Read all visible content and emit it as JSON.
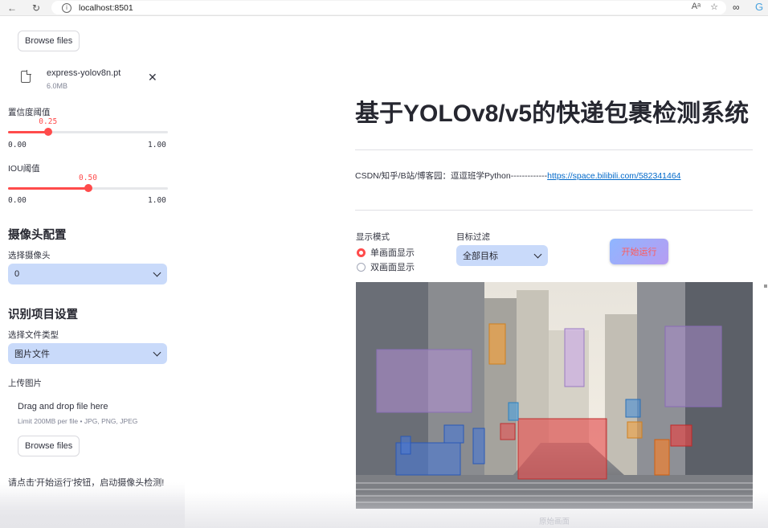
{
  "browser": {
    "url": "localhost:8501",
    "back": "←",
    "reload": "↻",
    "info": "i",
    "read_aloud": "Aᵃ",
    "favorite": "☆",
    "ext1": "∞",
    "ext2": "G"
  },
  "sidebar": {
    "browse_label_top": "Browse files",
    "file": {
      "name": "express-yolov8n.pt",
      "size": "6.0MB",
      "close": "✕"
    },
    "conf": {
      "label": "置信度阈值",
      "value": 0.25,
      "value_text": "0.25",
      "min": "0.00",
      "max": "1.00"
    },
    "iou": {
      "label": "IOU阈值",
      "value": 0.5,
      "value_text": "0.50",
      "min": "0.00",
      "max": "1.00"
    },
    "camera_section": "摄像头配置",
    "camera_label": "选择摄像头",
    "camera_value": "0",
    "recog_section": "识别项目设置",
    "file_type_label": "选择文件类型",
    "file_type_value": "图片文件",
    "upload_label": "上传图片",
    "drop_title": "Drag and drop file here",
    "drop_sub": "Limit 200MB per file • JPG, PNG, JPEG",
    "browse_label": "Browse files",
    "notice": "请点击'开始运行'按钮，启动摄像头检测!"
  },
  "main": {
    "title": "基于YOLOv8/v5的快递包裹检测系统",
    "credit_text": "CSDN/知乎/B站/博客园：逗逗班学Python-------------",
    "credit_link": "https://space.bilibili.com/582341464",
    "display_mode_label": "显示模式",
    "display_options": [
      "单画面显示",
      "双画面显示"
    ],
    "display_selected": 0,
    "filter_label": "目标过滤",
    "filter_value": "全部目标",
    "run_button": "开始运行",
    "caption": "原始画面"
  }
}
